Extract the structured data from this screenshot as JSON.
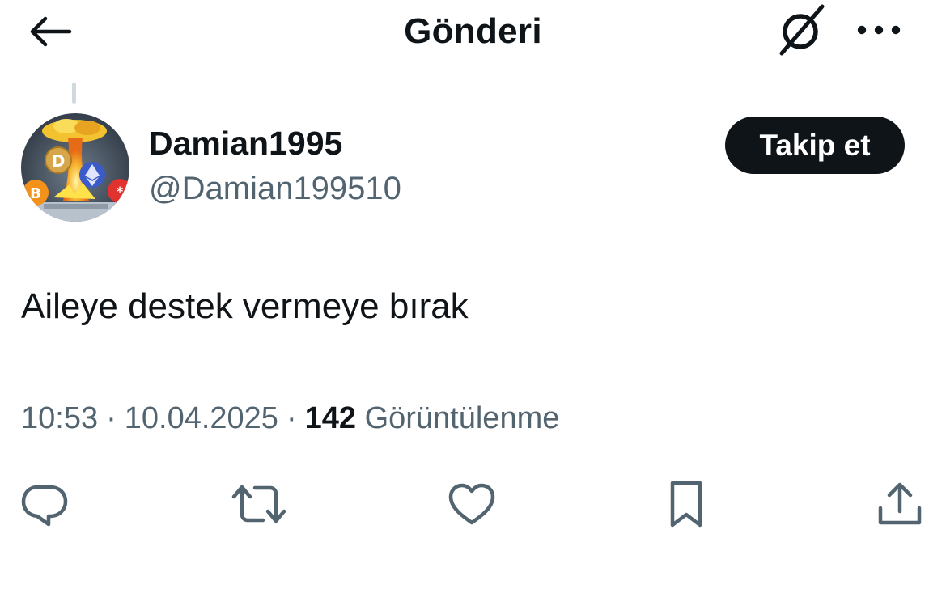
{
  "header": {
    "title": "Gönderi",
    "back_icon": "arrow-left-icon",
    "grok_icon": "grok-icon",
    "more_icon": "more-horizontal-icon"
  },
  "post": {
    "author": {
      "display_name": "Damian1995",
      "handle": "@Damian199510",
      "avatar": "crypto-explosion-avatar"
    },
    "follow_label": "Takip et",
    "text": "Aileye destek vermeye bırak",
    "time": "10:53",
    "date": "10.04.2025",
    "separator": "·",
    "views_count": "142",
    "views_label": "Görüntülenme"
  },
  "actions": {
    "reply_icon": "reply-icon",
    "repost_icon": "repost-icon",
    "like_icon": "heart-icon",
    "bookmark_icon": "bookmark-icon",
    "share_icon": "share-icon"
  },
  "colors": {
    "text_primary": "#0f1419",
    "text_secondary": "#536471",
    "follow_button_bg": "#0f1419",
    "thread_line": "#cfd9de"
  }
}
